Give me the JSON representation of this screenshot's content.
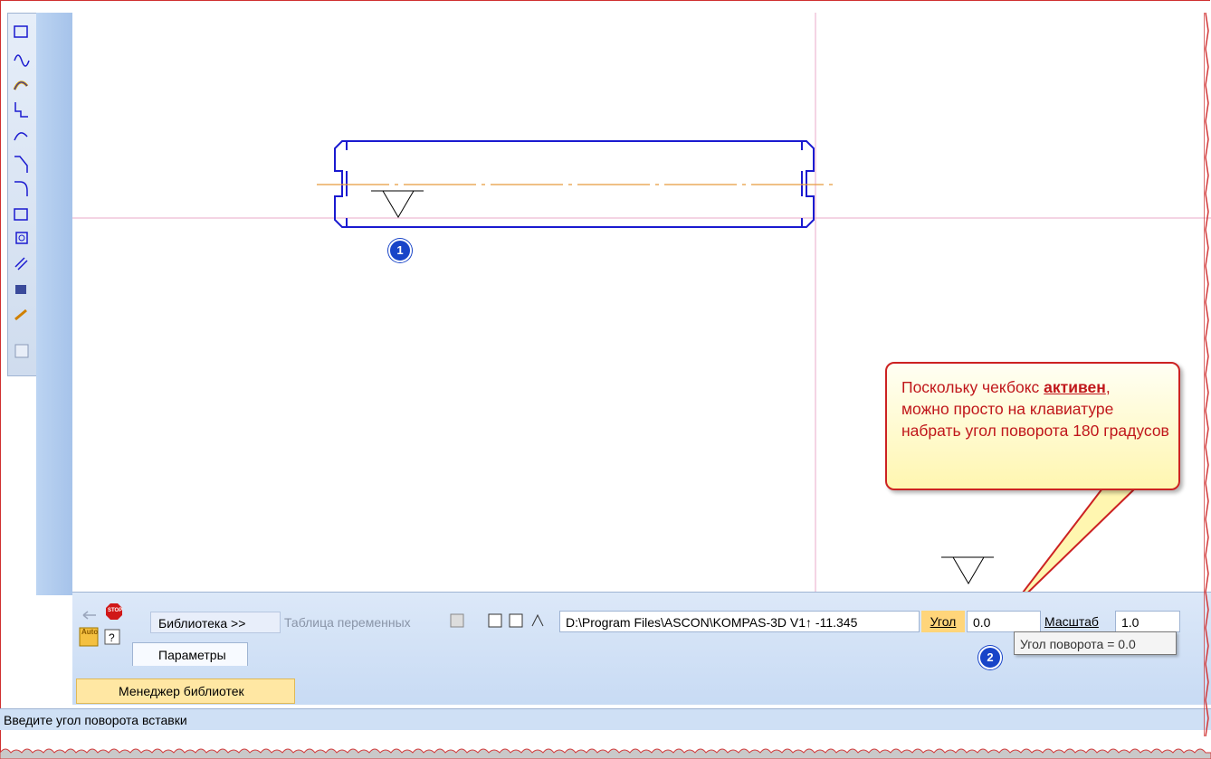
{
  "left_toolbar": {
    "icons": [
      "rectangle-icon",
      "curve-icon",
      "spline-icon",
      "polyline-icon",
      "bezier-icon",
      "chamfer-icon",
      "fillet-icon",
      "frame-icon",
      "copy-icon",
      "hatch-icon",
      "fill-icon",
      "brush-icon",
      "insert-icon"
    ]
  },
  "canvas": {
    "marker1": "1",
    "marker2": "2"
  },
  "callout": {
    "line1_prefix": "Поскольку чекбокс ",
    "line1_emph": "активен",
    "line1_suffix": ",",
    "rest": "можно просто на клавиатуре набрать угол поворота 180 градусов"
  },
  "toolbar": {
    "library_tab": "Библиотека",
    "library_arrow": ">>",
    "variables_tab": "Таблица переменных",
    "path_value": "D:\\Program Files\\ASCON\\KOMPAS-3D V1↑ -11.345",
    "angle_label": "Угол",
    "angle_value": "0.0",
    "scale_label": "Масштаб",
    "scale_value": "1.0",
    "auto_label": "Auto",
    "stop_label": "STOP"
  },
  "tooltip": {
    "text": "Угол поворота = 0.0"
  },
  "params_tab": {
    "label": "Параметры"
  },
  "library_manager": {
    "label": "Менеджер библиотек"
  },
  "status_bar": {
    "text": "Введите угол поворота вставки"
  },
  "colors": {
    "shape_outline": "#1a1ad0",
    "axis_line": "#e89a3c",
    "crosshair": "#e8a8c8",
    "marker": "#1844c8",
    "callout_text": "#c0171b",
    "callout_border": "#cc2222"
  }
}
